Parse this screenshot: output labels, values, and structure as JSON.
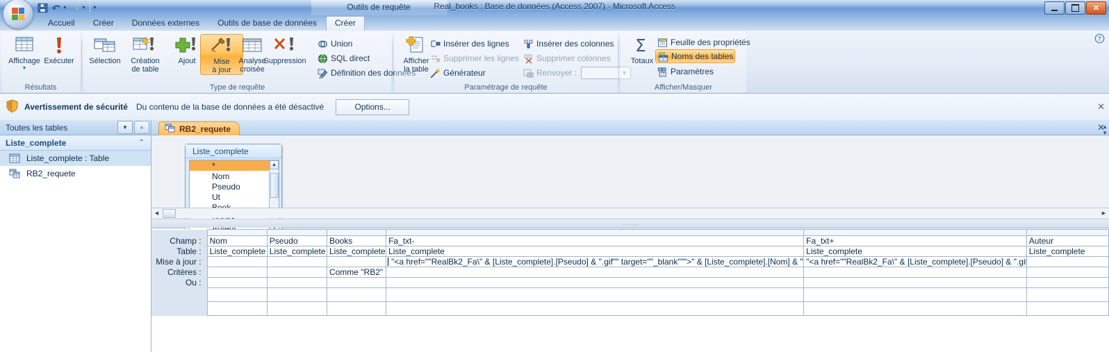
{
  "titlebar": {
    "document_title": "Real_books : Base de données (Access 2007) - Microsoft Access",
    "contextual_tab": "Outils de requête",
    "quick_access": [
      {
        "name": "save-icon",
        "tooltip": "Enregistrer"
      },
      {
        "name": "undo-icon",
        "tooltip": "Annuler"
      },
      {
        "name": "redo-icon",
        "tooltip": "Rétablir"
      },
      {
        "name": "customize-qat-icon",
        "tooltip": "Personnaliser"
      }
    ],
    "window_controls": {
      "minimize": "—",
      "maximize": "□",
      "close": "✕"
    }
  },
  "ribbon": {
    "tabs": [
      {
        "label": "Accueil",
        "active": false
      },
      {
        "label": "Créer",
        "active": false
      },
      {
        "label": "Données externes",
        "active": false
      },
      {
        "label": "Outils de base de données",
        "active": false
      },
      {
        "label": "Créer",
        "active": true
      }
    ],
    "groups": [
      {
        "title": "Résultats",
        "buttons": [
          {
            "label": "Affichage",
            "icon": "view-datasheet-icon",
            "has_dropdown": true,
            "selected": false
          },
          {
            "label": "Exécuter",
            "icon": "run-exclamation-icon",
            "has_dropdown": false,
            "selected": false
          }
        ]
      },
      {
        "title": "Type de requête",
        "buttons": [
          {
            "label": "Sélection",
            "icon": "select-query-icon",
            "selected": false
          },
          {
            "label": "Création\nde table",
            "label_line1": "Création",
            "label_line2": "de table",
            "icon": "make-table-query-icon",
            "selected": false
          },
          {
            "label": "Ajout",
            "icon": "append-query-icon",
            "selected": false
          },
          {
            "label": "Mise\nà jour",
            "label_line1": "Mise",
            "label_line2": "à jour",
            "icon": "update-query-icon",
            "selected": true
          },
          {
            "label": "Analyse\ncroisée",
            "label_line1": "Analyse",
            "label_line2": "croisée",
            "icon": "crosstab-query-icon",
            "selected": false
          },
          {
            "label": "Suppression",
            "icon": "delete-query-icon",
            "selected": false
          }
        ],
        "small_buttons": [
          {
            "label": "Union",
            "icon": "union-icon",
            "disabled": false
          },
          {
            "label": "SQL direct",
            "icon": "pass-through-sql-icon",
            "disabled": false
          },
          {
            "label": "Définition des données",
            "icon": "data-definition-icon",
            "disabled": false
          }
        ]
      },
      {
        "title": "Paramétrage de requête",
        "big_button": {
          "label_line1": "Afficher",
          "label_line2": "la table",
          "icon": "show-table-icon"
        },
        "small_buttons_col1": [
          {
            "label": "Insérer des lignes",
            "icon": "insert-rows-icon",
            "disabled": false
          },
          {
            "label": "Supprimer les lignes",
            "icon": "delete-rows-icon",
            "disabled": true
          },
          {
            "label": "Générateur",
            "icon": "builder-wand-icon",
            "disabled": false
          }
        ],
        "small_buttons_col2": [
          {
            "label": "Insérer des colonnes",
            "icon": "insert-columns-icon",
            "disabled": false
          },
          {
            "label": "Supprimer colonnes",
            "icon": "delete-columns-icon",
            "disabled": true
          },
          {
            "label": "Renvoyer :",
            "icon": "return-top-values-icon",
            "disabled": true
          }
        ],
        "return_combo_value": ""
      },
      {
        "title": "Afficher/Masquer",
        "big_button": {
          "label": "Totaux",
          "icon": "sigma-totals-icon"
        },
        "small_buttons": [
          {
            "label": "Feuille des propriétés",
            "icon": "property-sheet-icon",
            "selected": false
          },
          {
            "label": "Noms des tables",
            "icon": "table-names-icon",
            "selected": true
          },
          {
            "label": "Paramètres",
            "icon": "parameters-icon",
            "selected": false
          }
        ]
      }
    ],
    "help_icon": "help-question-icon"
  },
  "security_bar": {
    "icon": "security-shield-icon",
    "title": "Avertissement de sécurité",
    "message": "Du contenu de la base de données a été désactivé",
    "button_label": "Options...",
    "close_label": "✕"
  },
  "nav_pane": {
    "header_title": "Toutes les tables",
    "header_dropdown_icon": "chevron-down-icon",
    "header_collapse_icon": "double-chevron-left-icon",
    "group": {
      "title": "Liste_complete",
      "chevron": "⌃"
    },
    "items": [
      {
        "label": "Liste_complete : Table",
        "icon": "table-icon",
        "selected": true
      },
      {
        "label": "RB2_requete",
        "icon": "query-icon",
        "selected": false
      }
    ]
  },
  "document": {
    "tab_label": "RB2_requete",
    "tab_icon": "query-icon",
    "close_label": "✕"
  },
  "design_pane": {
    "table_box": {
      "title": "Liste_complete",
      "fields": [
        "*",
        "Nom",
        "Pseudo",
        "Ut",
        "Book",
        "Books",
        "Auteur"
      ],
      "selected_field": "*",
      "scroll_up_icon": "triangle-up-icon",
      "scroll_down_icon": "triangle-down-icon"
    },
    "hscroll": {
      "left_icon": "triangle-left-icon",
      "right_icon": "triangle-right-icon"
    },
    "splitter_dots": "........"
  },
  "query_grid": {
    "row_labels": [
      "Champ :",
      "Table :",
      "Mise à jour :",
      "Critères :",
      "Ou :"
    ],
    "columns": [
      {
        "champ": "Nom",
        "table": "Liste_complete",
        "mise_a_jour": "",
        "criteres": "",
        "ou": ""
      },
      {
        "champ": "Pseudo",
        "table": "Liste_complete",
        "mise_a_jour": "",
        "criteres": "",
        "ou": ""
      },
      {
        "champ": "Books",
        "table": "Liste_complete",
        "mise_a_jour": "",
        "criteres": "Comme \"RB2\"",
        "ou": ""
      },
      {
        "champ": "Fa_txt-",
        "table": "Liste_complete",
        "mise_a_jour": "\"<a href=\"\"RealBk2_Fa\\\" & [Liste_complete].[Pseudo] & \".gif\"\" target=\"\"_blank\"\"\">\" & [Liste_complete].[Nom] & \"</a>\"",
        "criteres": "",
        "ou": "",
        "has_caret": true
      },
      {
        "champ": "Fa_txt+",
        "table": "Liste_complete",
        "mise_a_jour": "\"<a href=\"\"RealBk2_Fa\\\" & [Liste_complete].[Pseudo] & \".gif\"\" t",
        "criteres": "",
        "ou": ""
      },
      {
        "champ": "Auteur",
        "table": "Liste_complete",
        "mise_a_jour": "",
        "criteres": "",
        "ou": ""
      }
    ]
  }
}
